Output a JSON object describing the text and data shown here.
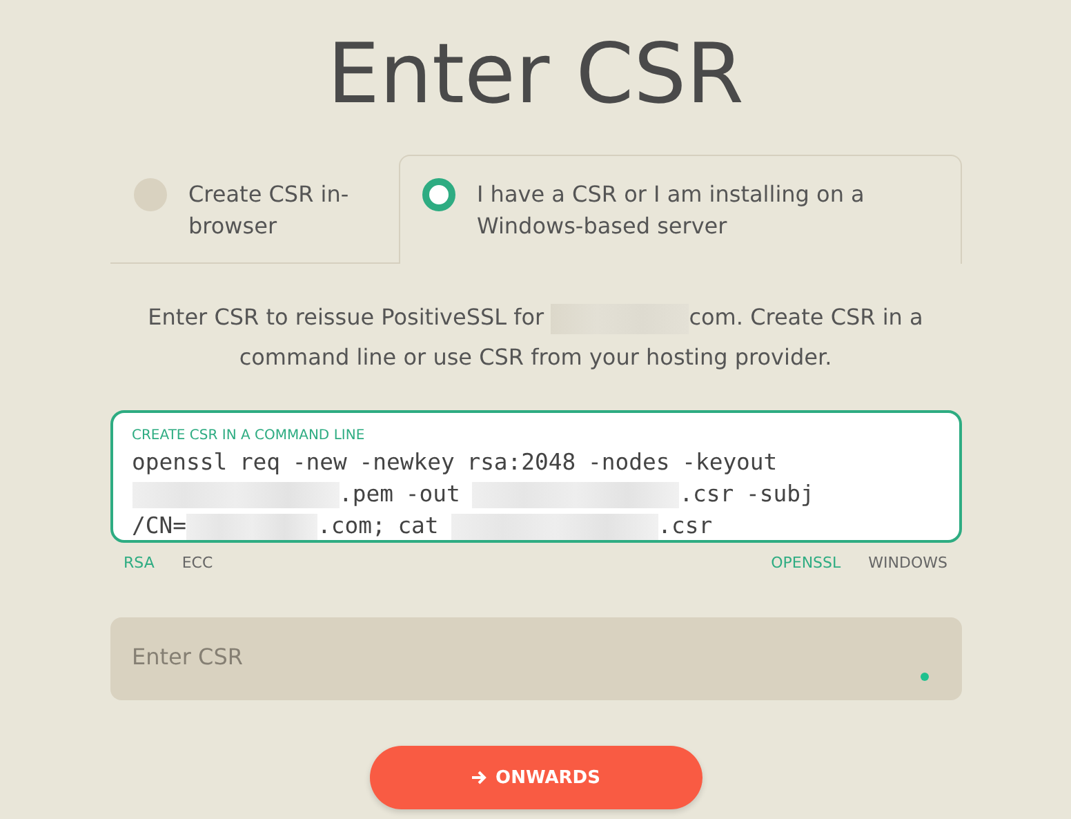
{
  "title": "Enter CSR",
  "tabs": [
    {
      "label": "Create CSR in-browser",
      "selected": false
    },
    {
      "label": "I have a CSR or I am installing on a Windows-based server",
      "selected": true
    }
  ],
  "intro": [
    {
      "kind": "text",
      "text": "Enter CSR to reissue PositiveSSL for "
    },
    {
      "kind": "redacted"
    },
    {
      "kind": "text",
      "text": "com. Create CSR in a command line or use CSR from your hosting provider."
    }
  ],
  "command_box": {
    "label": "CREATE CSR IN A COMMAND LINE",
    "command": [
      {
        "kind": "text",
        "text": "openssl req -new -newkey rsa:2048 -nodes -keyout "
      },
      {
        "kind": "redacted"
      },
      {
        "kind": "text",
        "text": ".pem -out "
      },
      {
        "kind": "redacted"
      },
      {
        "kind": "text",
        "text": ".csr -subj /CN="
      },
      {
        "kind": "redacted"
      },
      {
        "kind": "text",
        "text": ".com; cat "
      },
      {
        "kind": "redacted"
      },
      {
        "kind": "text",
        "text": ".csr"
      }
    ]
  },
  "key_types": [
    {
      "label": "RSA",
      "selected": true
    },
    {
      "label": "ECC",
      "selected": false
    }
  ],
  "platforms": [
    {
      "label": "OPENSSL",
      "selected": true
    },
    {
      "label": "WINDOWS",
      "selected": false
    }
  ],
  "csr_field": {
    "placeholder": "Enter CSR"
  },
  "button": {
    "label": "ONWARDS"
  }
}
